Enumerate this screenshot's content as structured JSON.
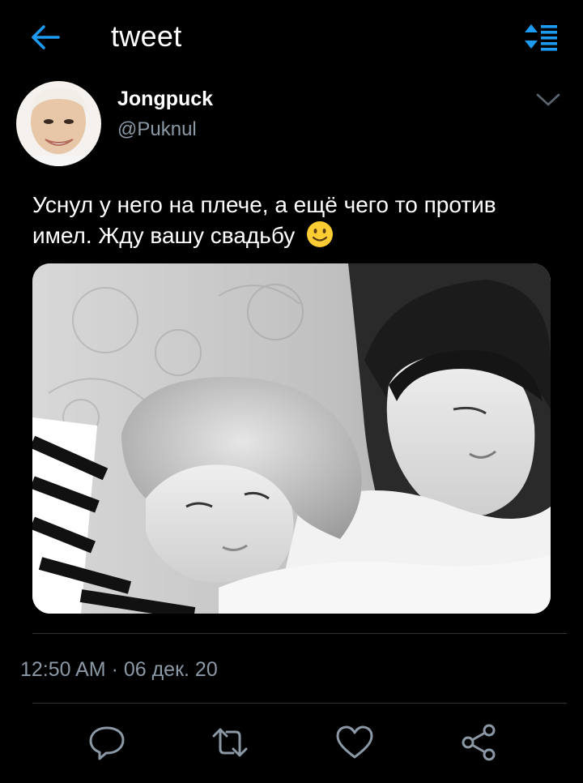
{
  "header": {
    "title": "tweet",
    "back_icon": "arrow-left-icon",
    "sort_icon": "sort-list-icon",
    "accent_color": "#1d9bf0"
  },
  "tweet": {
    "author_name": "Jongpuck",
    "author_handle": "@Puknul",
    "text": "Уснул у него на плече, а ещё чего то против имел. Жду вашу свадьбу",
    "emoji_icon": "slightly-smiling-face-icon",
    "timestamp": "12:50 AM · 06 дек. 20"
  },
  "actions": {
    "reply_icon": "reply-icon",
    "retweet_icon": "retweet-icon",
    "like_icon": "heart-icon",
    "share_icon": "share-icon"
  }
}
